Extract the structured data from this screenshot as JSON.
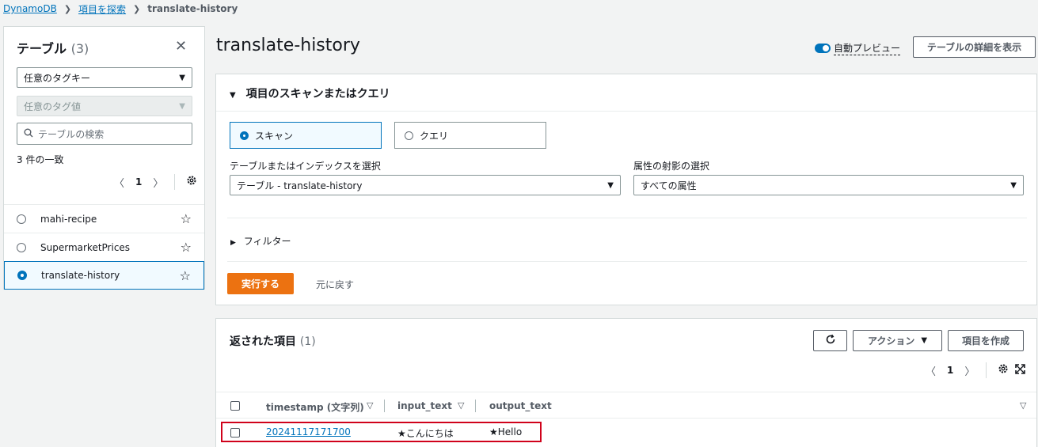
{
  "breadcrumb": {
    "root": "DynamoDB",
    "explore": "項目を探索",
    "current": "translate-history"
  },
  "left_panel": {
    "title": "テーブル",
    "count": "(3)",
    "tag_key_placeholder": "任意のタグキー",
    "tag_value_placeholder": "任意のタグ値",
    "search_placeholder": "テーブルの検索",
    "match_text": "3 件の一致",
    "page": "1",
    "tables": [
      {
        "name": "mahi-recipe",
        "selected": false
      },
      {
        "name": "SupermarketPrices",
        "selected": false
      },
      {
        "name": "translate-history",
        "selected": true
      }
    ]
  },
  "main": {
    "title": "translate-history",
    "auto_preview_label": "自動プレビュー",
    "details_button": "テーブルの詳細を表示"
  },
  "scan_panel": {
    "header": "項目のスキャンまたはクエリ",
    "scan_label": "スキャン",
    "query_label": "クエリ",
    "selected_mode": "scan",
    "table_index_label": "テーブルまたはインデックスを選択",
    "table_index_value": "テーブル - translate-history",
    "projection_label": "属性の射影の選択",
    "projection_value": "すべての属性",
    "filter_label": "フィルター",
    "run_button": "実行する",
    "reset_button": "元に戻す"
  },
  "results": {
    "title": "返された項目",
    "count": "(1)",
    "actions_button": "アクション",
    "create_button": "項目を作成",
    "page": "1",
    "columns": [
      "timestamp (文字列)",
      "input_text",
      "output_text"
    ],
    "rows": [
      {
        "timestamp": "20241117171700",
        "input_text": "★こんにちは",
        "output_text": "★Hello"
      }
    ]
  },
  "colors": {
    "primary": "#0073bb",
    "run_button": "#ec7211",
    "highlight": "#d0021b"
  }
}
